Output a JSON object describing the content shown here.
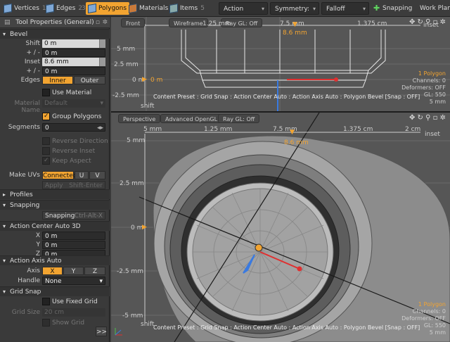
{
  "toolbar": {
    "tabs": [
      {
        "label": "Vertices",
        "num": "1"
      },
      {
        "label": "Edges",
        "num": "2"
      },
      {
        "label": "Polygons",
        "num": "3"
      },
      {
        "label": "Materials",
        "num": ""
      },
      {
        "label": "Items",
        "num": "5"
      }
    ],
    "action_center": "Action Center",
    "symmetry": "Symmetry: Off",
    "falloff": "Falloff",
    "snapping": "Snapping",
    "work_plane": "Work Plane"
  },
  "panel": {
    "title": "Tool Properties (General)",
    "bevel": {
      "header": "Bevel",
      "shift_label": "Shift",
      "shift_value": "0 m",
      "pm_label": "+ / -",
      "pm_value": "0 m",
      "inset_label": "Inset",
      "inset_value": "8.6 mm",
      "pm2_label": "+ / -",
      "pm2_value": "0 m",
      "edges_label": "Edges",
      "inner": "Inner",
      "outer": "Outer",
      "use_material": "Use Material",
      "material_label": "Material Name",
      "material_value": "Default",
      "group_polygons": "Group Polygons",
      "segments_label": "Segments",
      "segments_value": "0",
      "reverse_direction": "Reverse Direction",
      "reverse_inset": "Reverse Inset",
      "keep_aspect": "Keep Aspect",
      "make_uvs_label": "Make UVs",
      "uv_connected": "Connected",
      "uv_u": "U",
      "uv_v": "V",
      "apply": "Apply",
      "apply_shortcut": "Shift-Enter"
    },
    "profiles": "Profiles",
    "snapping": {
      "header": "Snapping",
      "btn": "Snapping",
      "shortcut": "Ctrl-Alt-X"
    },
    "action_center": {
      "header": "Action Center Auto 3D",
      "x_label": "X",
      "x": "0 m",
      "y_label": "Y",
      "y": "0 m",
      "z_label": "Z",
      "z": "0 m"
    },
    "action_axis": {
      "header": "Action Axis Auto",
      "axis_label": "Axis",
      "x": "X",
      "y": "Y",
      "z": "Z",
      "handle_label": "Handle",
      "handle_value": "None"
    },
    "grid_snap": {
      "header": "Grid Snap",
      "use_fixed_grid": "Use Fixed Grid",
      "grid_size_label": "Grid Size",
      "grid_size_value": "20 cm",
      "show_grid": "Show Grid"
    },
    "expand": ">>"
  },
  "viewport_top": {
    "tabs": [
      "Front",
      "Wireframe",
      "Ray GL: Off"
    ],
    "ruler": [
      "1.25 mm",
      "7.5 mm",
      "1.375 cm"
    ],
    "ruler_value": "8.6 mm",
    "inset_label": "inset",
    "axis": [
      "5 mm",
      "2.5 mm",
      "0 m",
      "-2.5 mm"
    ],
    "axis_marker": "0 m",
    "shift": "shift",
    "hud": {
      "polygons": "1 Polygon",
      "channels": "Channels: 0",
      "deformers": "Deformers: OFF",
      "gl": "GL: 550",
      "scale": "5 mm"
    },
    "status": "Content Preset : Grid Snap : Action Center Auto : Action Axis Auto : Polygon Bevel  [Snap : OFF]"
  },
  "viewport_bottom": {
    "tabs": [
      "Perspective",
      "Advanced OpenGL",
      "Ray GL: Off"
    ],
    "ruler": [
      "5 mm",
      "1.25 mm",
      "7.5 mm",
      "1.375 cm",
      "2 cm"
    ],
    "ruler_value": "8.6 mm",
    "inset_label": "inset",
    "axis": [
      "5 mm",
      "2.5 mm",
      "0 m",
      "-2.5 mm",
      "-5 mm"
    ],
    "shift": "shift",
    "hud": {
      "polygons": "1 Polygon",
      "channels": "Channels: 0",
      "deformers": "Deformers: OFF",
      "gl": "GL: 550",
      "scale": "5 mm"
    },
    "status": "Content Preset : Grid Snap : Action Center Auto : Action Axis Auto : Polygon Bevel  [Snap : OFF]"
  },
  "colors": {
    "accent": "#f2a431",
    "viewport": "#565656",
    "panel": "#3a3a3a"
  }
}
